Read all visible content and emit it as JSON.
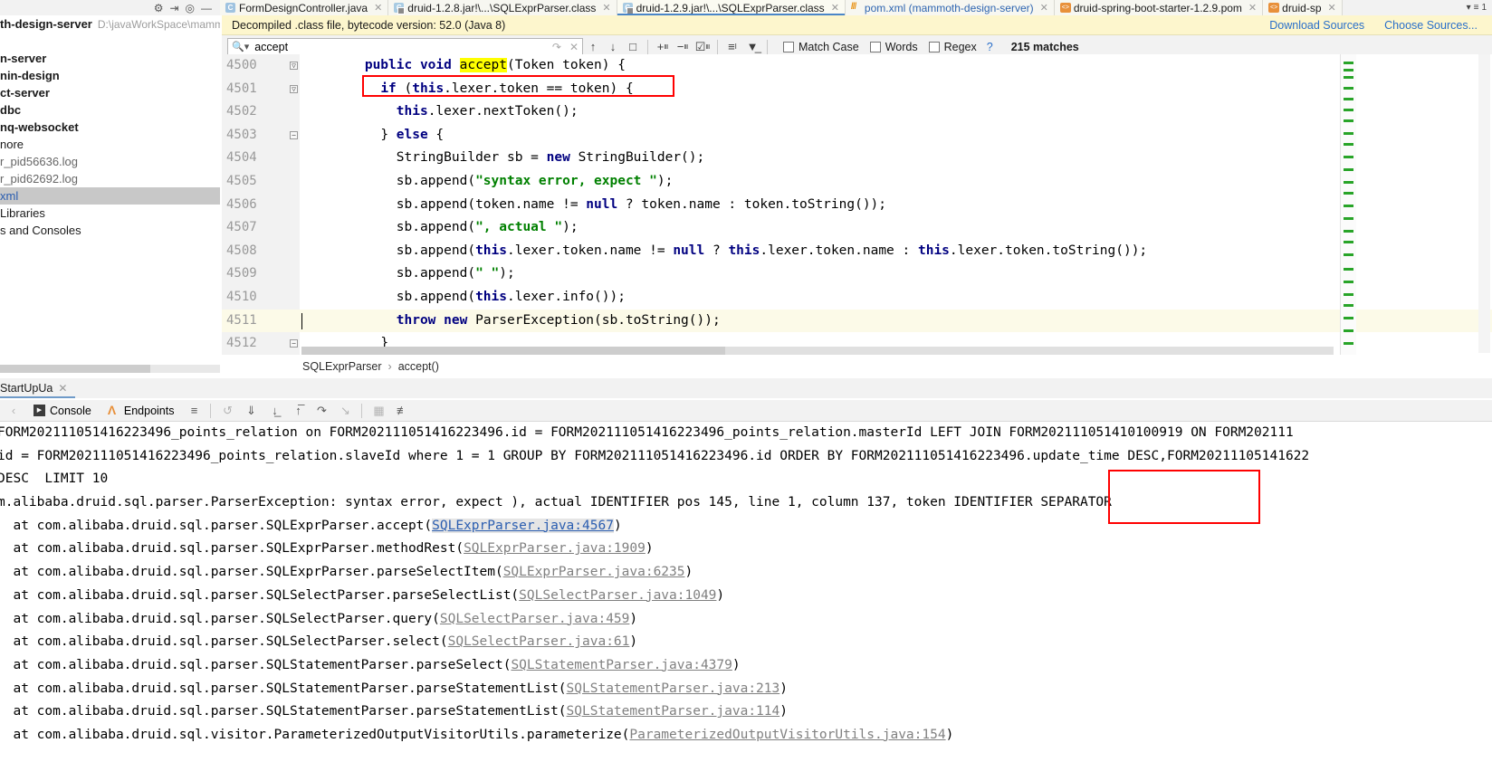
{
  "tabs": {
    "left_icons": [
      "settings-icon",
      "collapse-icon",
      "locate-icon",
      "minimize-icon"
    ],
    "items": [
      {
        "label": "FormDesignController.java",
        "icon": "java-file-icon",
        "state": "inactive",
        "blue": false
      },
      {
        "label": "druid-1.2.8.jar!\\...\\SQLExprParser.class",
        "icon": "class-file-icon",
        "state": "inactive",
        "blue": false
      },
      {
        "label": "druid-1.2.9.jar!\\...\\SQLExprParser.class",
        "icon": "class-file-icon",
        "state": "active",
        "blue": false
      },
      {
        "label": "pom.xml (mammoth-design-server)",
        "icon": "xml-file-icon",
        "state": "inactive",
        "blue": true
      },
      {
        "label": "druid-spring-boot-starter-1.2.9.pom",
        "icon": "pom-file-icon",
        "state": "inactive",
        "blue": false
      },
      {
        "label": "druid-sp",
        "icon": "pom-file-icon",
        "state": "inactive",
        "blue": false
      }
    ],
    "overflow_label": "1"
  },
  "project_panel": {
    "rows": [
      {
        "name": "th-design-server",
        "path": "D:\\javaWorkSpace\\mamm",
        "bold": true,
        "selected": false,
        "style": ""
      },
      {
        "name": "",
        "path": "",
        "bold": false,
        "selected": false,
        "style": ""
      },
      {
        "name": "n-server",
        "path": "",
        "bold": true,
        "selected": false,
        "style": ""
      },
      {
        "name": "nin-design",
        "path": "",
        "bold": true,
        "selected": false,
        "style": ""
      },
      {
        "name": "ct-server",
        "path": "",
        "bold": true,
        "selected": false,
        "style": ""
      },
      {
        "name": "dbc",
        "path": "",
        "bold": true,
        "selected": false,
        "style": ""
      },
      {
        "name": "nq-websocket",
        "path": "",
        "bold": true,
        "selected": false,
        "style": ""
      },
      {
        "name": "nore",
        "path": "",
        "bold": false,
        "selected": false,
        "style": ""
      },
      {
        "name": "r_pid56636.log",
        "path": "",
        "bold": false,
        "selected": false,
        "style": "gray"
      },
      {
        "name": "r_pid62692.log",
        "path": "",
        "bold": false,
        "selected": false,
        "style": "gray"
      },
      {
        "name": "xml",
        "path": "",
        "bold": false,
        "selected": true,
        "style": "blue"
      },
      {
        "name": "Libraries",
        "path": "",
        "bold": false,
        "selected": false,
        "style": ""
      },
      {
        "name": "s and Consoles",
        "path": "",
        "bold": false,
        "selected": false,
        "style": ""
      }
    ]
  },
  "notification": {
    "text": "Decompiled .class file, bytecode version: 52.0 (Java 8)",
    "download_sources": "Download Sources",
    "choose_sources": "Choose Sources..."
  },
  "find": {
    "query": "accept",
    "placeholder": "Search",
    "match_case": "Match Case",
    "match_case_checked": false,
    "words": "Words",
    "words_checked": false,
    "regex": "Regex",
    "regex_checked": false,
    "help": "?",
    "matches": "215 matches"
  },
  "editor": {
    "lines": [
      {
        "num": "4500",
        "indent": 8,
        "fold": "open",
        "highlight": false,
        "tokens": [
          {
            "t": "public ",
            "c": "kw"
          },
          {
            "t": "void ",
            "c": "kw"
          },
          {
            "t": "accept",
            "c": "mark"
          },
          {
            "t": "(Token token) {",
            "c": ""
          }
        ]
      },
      {
        "num": "4501",
        "indent": 10,
        "fold": "open",
        "highlight": false,
        "tokens": [
          {
            "t": "if ",
            "c": "kw"
          },
          {
            "t": "(",
            "c": ""
          },
          {
            "t": "this",
            "c": "kw"
          },
          {
            "t": ".lexer.token == token) {",
            "c": ""
          }
        ]
      },
      {
        "num": "4502",
        "indent": 12,
        "fold": "",
        "highlight": false,
        "tokens": [
          {
            "t": "this",
            "c": "kw"
          },
          {
            "t": ".lexer.nextToken();",
            "c": ""
          }
        ]
      },
      {
        "num": "4503",
        "indent": 10,
        "fold": "close",
        "highlight": false,
        "tokens": [
          {
            "t": "} ",
            "c": ""
          },
          {
            "t": "else",
            "c": "kw"
          },
          {
            "t": " {",
            "c": ""
          }
        ]
      },
      {
        "num": "4504",
        "indent": 12,
        "fold": "",
        "highlight": false,
        "tokens": [
          {
            "t": "StringBuilder sb = ",
            "c": ""
          },
          {
            "t": "new",
            "c": "kw"
          },
          {
            "t": " StringBuilder();",
            "c": ""
          }
        ]
      },
      {
        "num": "4505",
        "indent": 12,
        "fold": "",
        "highlight": false,
        "tokens": [
          {
            "t": "sb.append(",
            "c": ""
          },
          {
            "t": "\"syntax error, expect \"",
            "c": "str"
          },
          {
            "t": ");",
            "c": ""
          }
        ]
      },
      {
        "num": "4506",
        "indent": 12,
        "fold": "",
        "highlight": false,
        "tokens": [
          {
            "t": "sb.append(token.name != ",
            "c": ""
          },
          {
            "t": "null",
            "c": "kw"
          },
          {
            "t": " ? token.name : token.toString());",
            "c": ""
          }
        ]
      },
      {
        "num": "4507",
        "indent": 12,
        "fold": "",
        "highlight": false,
        "tokens": [
          {
            "t": "sb.append(",
            "c": ""
          },
          {
            "t": "\", actual \"",
            "c": "str"
          },
          {
            "t": ");",
            "c": ""
          }
        ]
      },
      {
        "num": "4508",
        "indent": 12,
        "fold": "",
        "highlight": false,
        "tokens": [
          {
            "t": "sb.append(",
            "c": ""
          },
          {
            "t": "this",
            "c": "kw"
          },
          {
            "t": ".lexer.token.name != ",
            "c": ""
          },
          {
            "t": "null",
            "c": "kw"
          },
          {
            "t": " ? ",
            "c": ""
          },
          {
            "t": "this",
            "c": "kw"
          },
          {
            "t": ".lexer.token.name : ",
            "c": ""
          },
          {
            "t": "this",
            "c": "kw"
          },
          {
            "t": ".lexer.token.toString());",
            "c": ""
          }
        ]
      },
      {
        "num": "4509",
        "indent": 12,
        "fold": "",
        "highlight": false,
        "tokens": [
          {
            "t": "sb.append(",
            "c": ""
          },
          {
            "t": "\" \"",
            "c": "str"
          },
          {
            "t": ");",
            "c": ""
          }
        ]
      },
      {
        "num": "4510",
        "indent": 12,
        "fold": "",
        "highlight": false,
        "tokens": [
          {
            "t": "sb.append(",
            "c": ""
          },
          {
            "t": "this",
            "c": "kw"
          },
          {
            "t": ".lexer.info());",
            "c": ""
          }
        ]
      },
      {
        "num": "4511",
        "indent": 12,
        "fold": "",
        "highlight": true,
        "tokens": [
          {
            "t": "throw ",
            "c": "kw"
          },
          {
            "t": "new",
            "c": "kw"
          },
          {
            "t": " ParserException(sb.toString());",
            "c": ""
          }
        ]
      },
      {
        "num": "4512",
        "indent": 10,
        "fold": "close",
        "highlight": false,
        "tokens": [
          {
            "t": "}",
            "c": ""
          }
        ]
      }
    ],
    "breadcrumb": [
      "SQLExprParser",
      "accept()"
    ],
    "breadcrumb_separator": "›"
  },
  "run_panel": {
    "tab_label": "StartUpUa",
    "console_label": "Console",
    "endpoints_label": "Endpoints"
  },
  "console_output": {
    "lines": [
      {
        "segments": [
          {
            "t": "FORM202111051416223496_points_relation on FORM202111051416223496.id = FORM202111051416223496_points_relation.masterId LEFT JOIN FORM202111051410100919 ON FORM202111",
            "c": "clip"
          }
        ]
      },
      {
        "segments": [
          {
            "t": "id = FORM202111051416223496_points_relation.slaveId where 1 = 1 GROUP BY FORM202111051416223496.id ORDER BY FORM202111051416223496.update_time DESC,FORM20211105141622",
            "c": ""
          }
        ]
      },
      {
        "segments": [
          {
            "t": "DESC  LIMIT 10",
            "c": ""
          }
        ]
      },
      {
        "segments": [
          {
            "t": "m.alibaba.druid.sql.parser.ParserException: syntax error, expect ), actual IDENTIFIER pos 145, line 1, column 137, token IDENTIFIER SEPARATOR",
            "c": ""
          }
        ]
      },
      {
        "segments": [
          {
            "t": "  at com.alibaba.druid.sql.parser.SQLExprParser.accept(",
            "c": ""
          },
          {
            "t": "SQLExprParser.java:4567",
            "c": "lnk-hot"
          },
          {
            "t": ")",
            "c": ""
          }
        ]
      },
      {
        "segments": [
          {
            "t": "  at com.alibaba.druid.sql.parser.SQLExprParser.methodRest(",
            "c": ""
          },
          {
            "t": "SQLExprParser.java:1909",
            "c": "dimlnk"
          },
          {
            "t": ")",
            "c": ""
          }
        ]
      },
      {
        "segments": [
          {
            "t": "  at com.alibaba.druid.sql.parser.SQLExprParser.parseSelectItem(",
            "c": ""
          },
          {
            "t": "SQLExprParser.java:6235",
            "c": "dimlnk"
          },
          {
            "t": ")",
            "c": ""
          }
        ]
      },
      {
        "segments": [
          {
            "t": "  at com.alibaba.druid.sql.parser.SQLSelectParser.parseSelectList(",
            "c": ""
          },
          {
            "t": "SQLSelectParser.java:1049",
            "c": "dimlnk"
          },
          {
            "t": ")",
            "c": ""
          }
        ]
      },
      {
        "segments": [
          {
            "t": "  at com.alibaba.druid.sql.parser.SQLSelectParser.query(",
            "c": ""
          },
          {
            "t": "SQLSelectParser.java:459",
            "c": "dimlnk"
          },
          {
            "t": ")",
            "c": ""
          }
        ]
      },
      {
        "segments": [
          {
            "t": "  at com.alibaba.druid.sql.parser.SQLSelectParser.select(",
            "c": ""
          },
          {
            "t": "SQLSelectParser.java:61",
            "c": "dimlnk"
          },
          {
            "t": ")",
            "c": ""
          }
        ]
      },
      {
        "segments": [
          {
            "t": "  at com.alibaba.druid.sql.parser.SQLStatementParser.parseSelect(",
            "c": ""
          },
          {
            "t": "SQLStatementParser.java:4379",
            "c": "dimlnk"
          },
          {
            "t": ")",
            "c": ""
          }
        ]
      },
      {
        "segments": [
          {
            "t": "  at com.alibaba.druid.sql.parser.SQLStatementParser.parseStatementList(",
            "c": ""
          },
          {
            "t": "SQLStatementParser.java:213",
            "c": "dimlnk"
          },
          {
            "t": ")",
            "c": ""
          }
        ]
      },
      {
        "segments": [
          {
            "t": "  at com.alibaba.druid.sql.parser.SQLStatementParser.parseStatementList(",
            "c": ""
          },
          {
            "t": "SQLStatementParser.java:114",
            "c": "dimlnk"
          },
          {
            "t": ")",
            "c": ""
          }
        ]
      },
      {
        "segments": [
          {
            "t": "  at com.alibaba.druid.sql.visitor.ParameterizedOutputVisitorUtils.parameterize(",
            "c": ""
          },
          {
            "t": "ParameterizedOutputVisitorUtils.java:154",
            "c": "dimlnk"
          },
          {
            "t": ")",
            "c": ""
          }
        ]
      }
    ]
  },
  "annotations": {
    "editor_box": {
      "label": "red-highlight-if-statement"
    },
    "console_box": {
      "label": "red-highlight-separator-token"
    }
  },
  "colors": {
    "accent": "#2a6fc9",
    "notification_bg": "#fdf6cd",
    "annotation": "#ff0000",
    "keyword": "#000080",
    "string": "#008000",
    "search_highlight": "#ffff00"
  }
}
